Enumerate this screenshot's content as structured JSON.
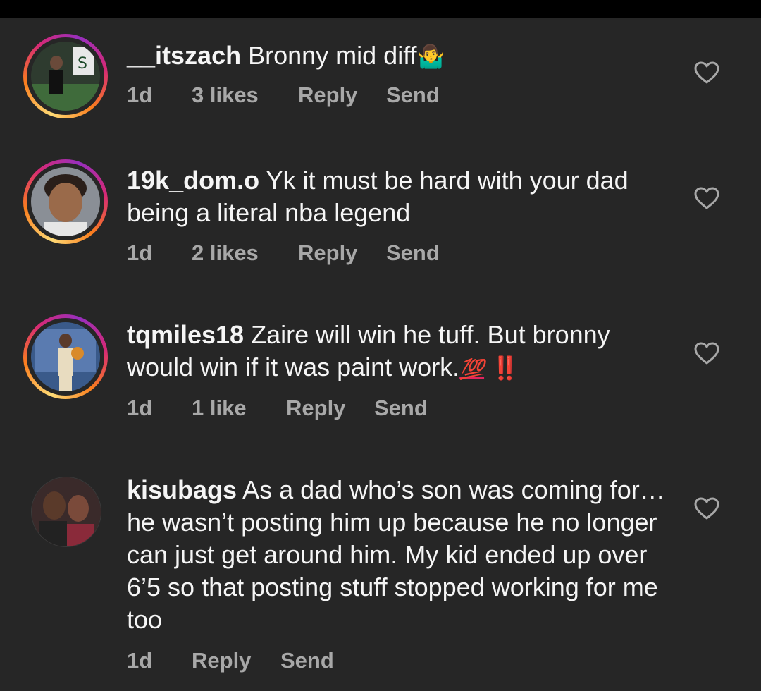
{
  "comments": [
    {
      "username": "__itszach",
      "text": "Bronny mid diff",
      "emoji": "🤷‍♂️",
      "time": "1d",
      "likes": "3 likes",
      "reply_label": "Reply",
      "send_label": "Send"
    },
    {
      "username": "19k_dom.o",
      "text": "Yk it must be hard with your dad being a literal nba legend",
      "time": "1d",
      "likes": "2 likes",
      "reply_label": "Reply",
      "send_label": "Send"
    },
    {
      "username": "tqmiles18",
      "text": "Zaire will win he tuff. But bronny would win if it was paint work.",
      "emoji_hundred": "💯",
      "emoji_bang": "‼️",
      "time": "1d",
      "likes": "1 like",
      "reply_label": "Reply",
      "send_label": "Send"
    },
    {
      "username": "kisubags",
      "text": "As a dad who’s son was coming for…he wasn’t posting him up because he no longer can just get around him. My kid ended up over 6’5 so that posting stuff stopped working for me too",
      "time": "1d",
      "reply_label": "Reply",
      "send_label": "Send"
    }
  ],
  "icons": {
    "like": "heart-outline-icon"
  },
  "colors": {
    "background": "#262626",
    "text": "#f5f5f5",
    "meta": "#a8a8a8",
    "story_ring_start": "#feda75",
    "story_ring_mid": "#d62976",
    "story_ring_end": "#962fbf"
  }
}
